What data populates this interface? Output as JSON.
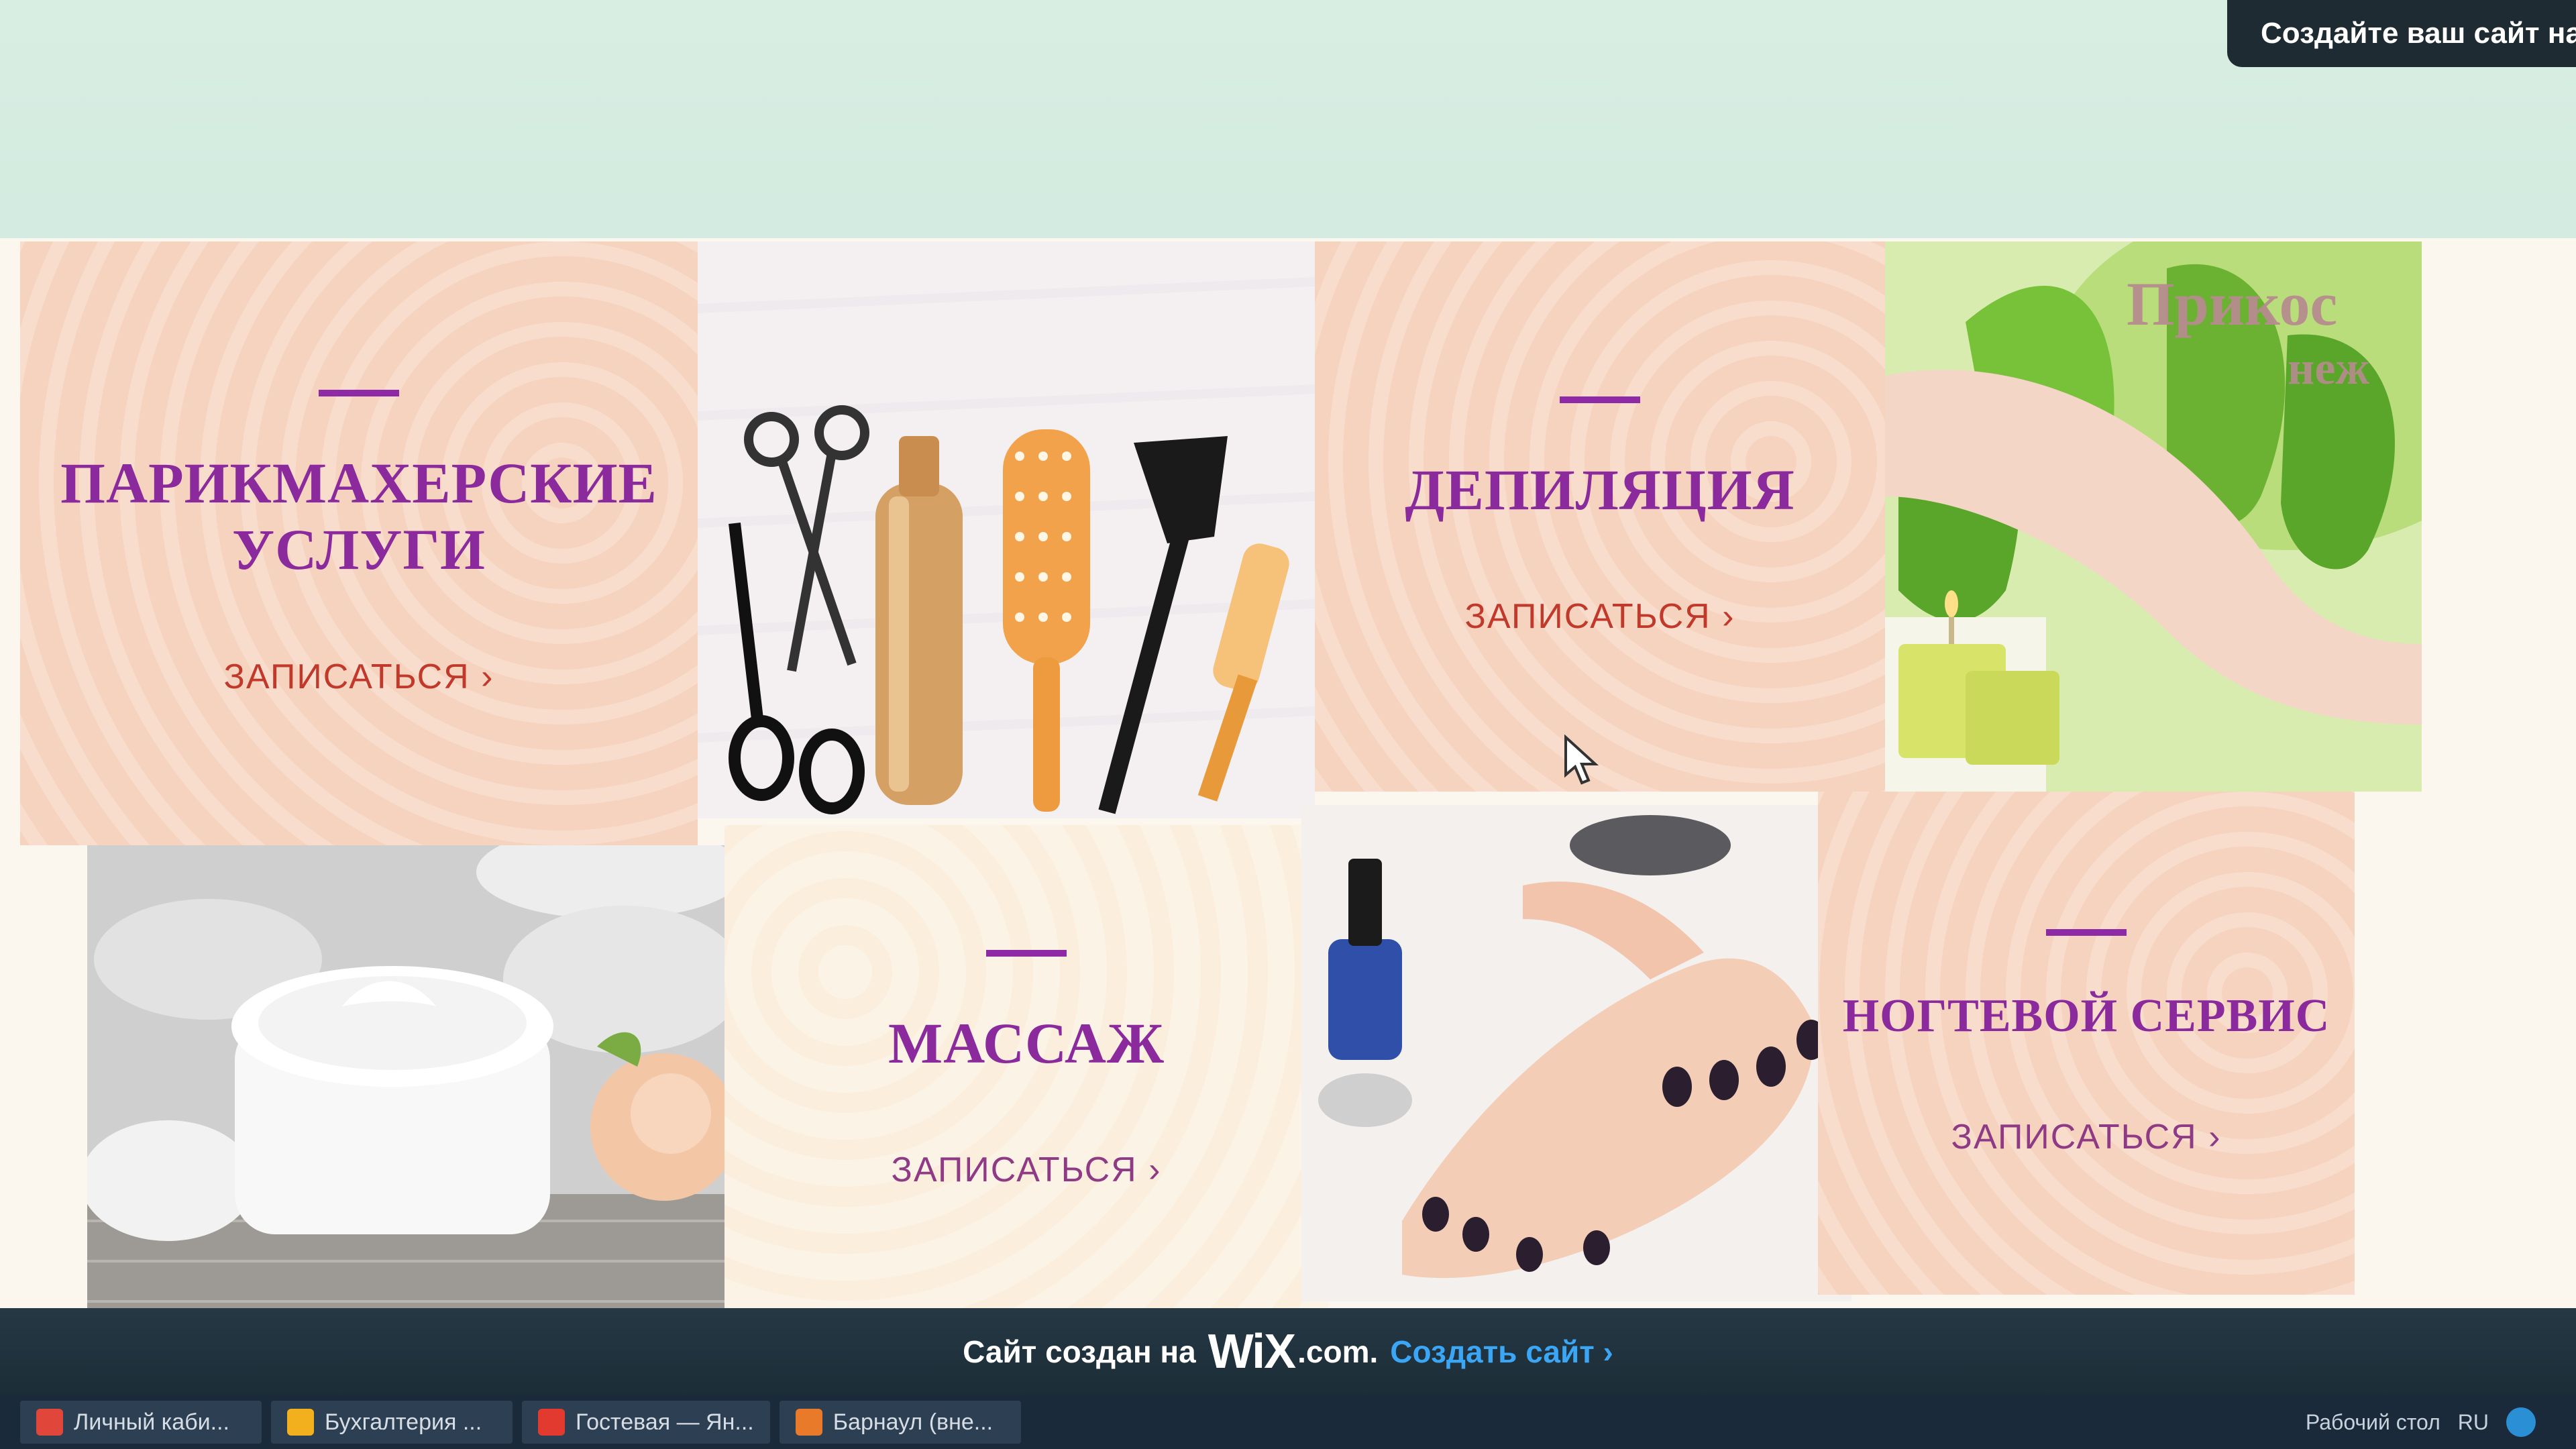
{
  "promo": {
    "text": "Создайте ваш сайт на"
  },
  "services": [
    {
      "title_line1": "ПАРИКМАХЕРСКИЕ",
      "title_line2": "УСЛУГИ",
      "action": "ЗАПИСАТЬСЯ ›"
    },
    {
      "title_line1": "ДЕПИЛЯЦИЯ",
      "title_line2": "",
      "action": "ЗАПИСАТЬСЯ ›"
    },
    {
      "title_line1": "МАССАЖ",
      "title_line2": "",
      "action": "ЗАПИСАТЬСЯ ›"
    },
    {
      "title_line1": "НОГТЕВОЙ СЕРВИС",
      "title_line2": "",
      "action": "ЗАПИСАТЬСЯ ›"
    }
  ],
  "photo_overlay": {
    "line1": "Прикос",
    "line2": "неж"
  },
  "wix_banner": {
    "prefix": "Сайт создан на",
    "logo": "WiX",
    "domain": ".com.",
    "link": "Создать сайт ›"
  },
  "taskbar": {
    "tasks": [
      {
        "label": "Личный каби...",
        "icon_color": "#e0463a"
      },
      {
        "label": "Бухгалтерия ...",
        "icon_color": "#f2b01e"
      },
      {
        "label": "Гостевая — Ян...",
        "icon_color": "#e23a2e"
      },
      {
        "label": "Барнаул (вне...",
        "icon_color": "#e87a2a"
      }
    ],
    "tray": {
      "desktop": "Рабочий стол",
      "lang": "RU"
    }
  },
  "colors": {
    "accent": "#8e2aa6",
    "action": "#c0392b",
    "wix_link": "#3aa6f5"
  }
}
